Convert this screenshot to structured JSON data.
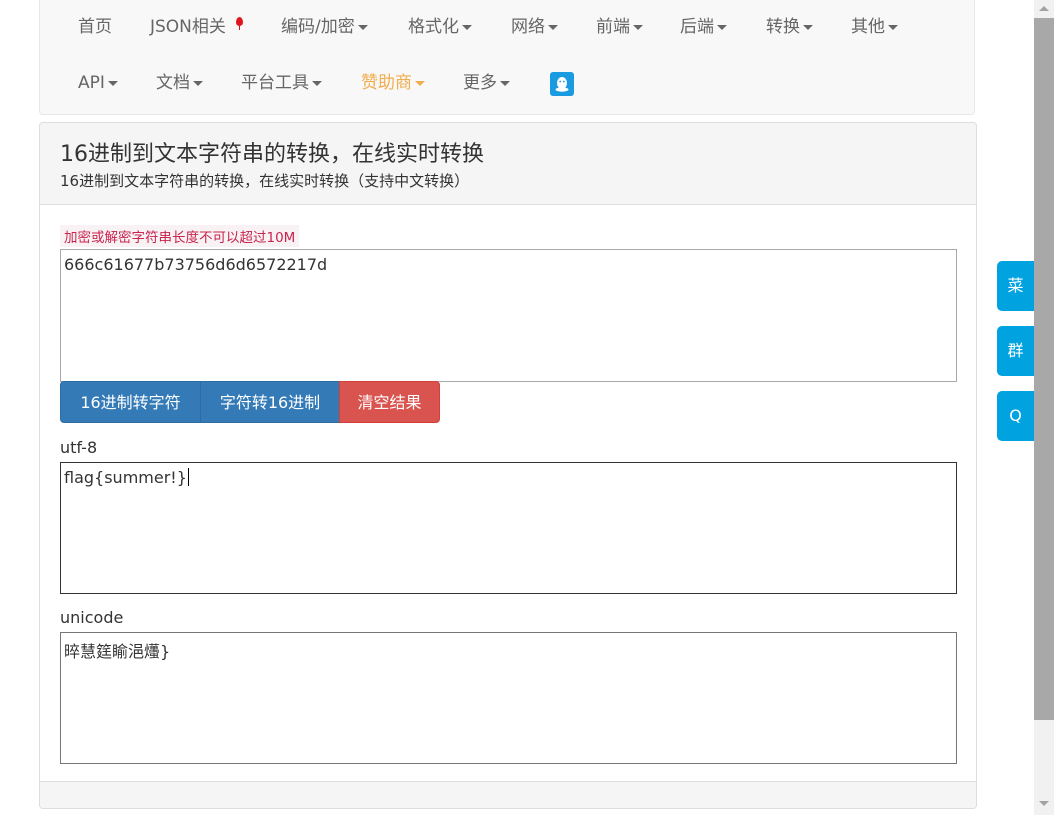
{
  "navbar": {
    "items": [
      {
        "label": "首页",
        "dropdown": false
      },
      {
        "label": "JSON相关",
        "dropdown": false,
        "badge": "red-dot"
      },
      {
        "label": "编码/加密",
        "dropdown": true
      },
      {
        "label": "格式化",
        "dropdown": true
      },
      {
        "label": "网络",
        "dropdown": true
      },
      {
        "label": "前端",
        "dropdown": true
      },
      {
        "label": "后端",
        "dropdown": true
      },
      {
        "label": "转换",
        "dropdown": true
      },
      {
        "label": "其他",
        "dropdown": true
      },
      {
        "label": "API",
        "dropdown": true
      },
      {
        "label": "文档",
        "dropdown": true
      },
      {
        "label": "平台工具",
        "dropdown": true
      },
      {
        "label": "赞助商",
        "dropdown": true,
        "highlight": "#f0ad4e"
      },
      {
        "label": "更多",
        "dropdown": true
      }
    ],
    "qq_icon": "qq-penguin-icon"
  },
  "panel": {
    "title": "16进制到文本字符串的转换，在线实时转换",
    "subtitle": "16进制到文本字符串的转换，在线实时转换（支持中文转换）"
  },
  "warning": "加密或解密字符串长度不可以超过10M",
  "input": {
    "value": "666c61677b73756d6d6572217d"
  },
  "buttons": {
    "hex_to_str": "16进制转字符",
    "str_to_hex": "字符转16进制",
    "clear": "清空结果"
  },
  "outputs": {
    "utf8_label": "utf-8",
    "utf8_value": "flag{summer!}",
    "unicode_label": "unicode",
    "unicode_value": "晬慧筳睮浥爡}"
  },
  "side": {
    "menu": "菜",
    "group": "群",
    "qq": "Q"
  },
  "colors": {
    "primary": "#337ab7",
    "danger": "#d9534f",
    "sponsor": "#f0ad4e",
    "side_accent": "#00a2e0",
    "warning_text": "#c7254e"
  }
}
